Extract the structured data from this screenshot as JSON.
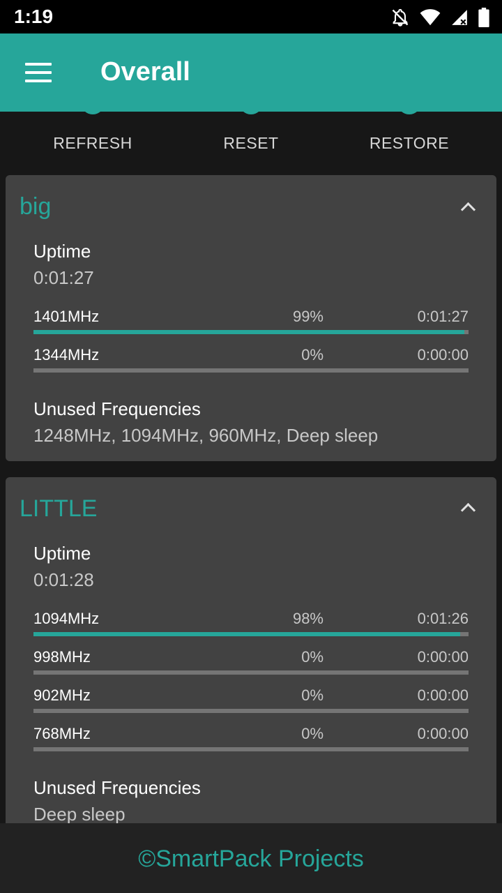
{
  "status_bar": {
    "time": "1:19",
    "icons": [
      "notifications-off-icon",
      "wifi-icon",
      "cell-signal-icon",
      "battery-icon"
    ]
  },
  "app_bar": {
    "title": "Overall",
    "menu_icon": "hamburger-menu-icon",
    "color": "#26a69a"
  },
  "actions": [
    {
      "label": "REFRESH",
      "icon": "refresh-icon"
    },
    {
      "label": "RESET",
      "icon": "reset-icon"
    },
    {
      "label": "RESTORE",
      "icon": "restore-icon"
    }
  ],
  "clusters": [
    {
      "title": "big",
      "uptime_label": "Uptime",
      "uptime_value": "0:01:27",
      "frequencies": [
        {
          "freq": "1401MHz",
          "percent": "99%",
          "time": "0:01:27",
          "fill": 0.99
        },
        {
          "freq": "1344MHz",
          "percent": "0%",
          "time": "0:00:00",
          "fill": 0
        }
      ],
      "unused_label": "Unused Frequencies",
      "unused_value": "1248MHz, 1094MHz, 960MHz, Deep sleep"
    },
    {
      "title": "LITTLE",
      "uptime_label": "Uptime",
      "uptime_value": "0:01:28",
      "frequencies": [
        {
          "freq": "1094MHz",
          "percent": "98%",
          "time": "0:01:26",
          "fill": 0.98
        },
        {
          "freq": "998MHz",
          "percent": "0%",
          "time": "0:00:00",
          "fill": 0
        },
        {
          "freq": "902MHz",
          "percent": "0%",
          "time": "0:00:00",
          "fill": 0
        },
        {
          "freq": "768MHz",
          "percent": "0%",
          "time": "0:00:00",
          "fill": 0
        }
      ],
      "unused_label": "Unused Frequencies",
      "unused_value": "Deep sleep"
    }
  ],
  "footer": {
    "text": "©SmartPack Projects"
  },
  "colors": {
    "accent": "#26a69a",
    "card": "#424242",
    "background": "#171717",
    "bar_track": "#757575"
  }
}
